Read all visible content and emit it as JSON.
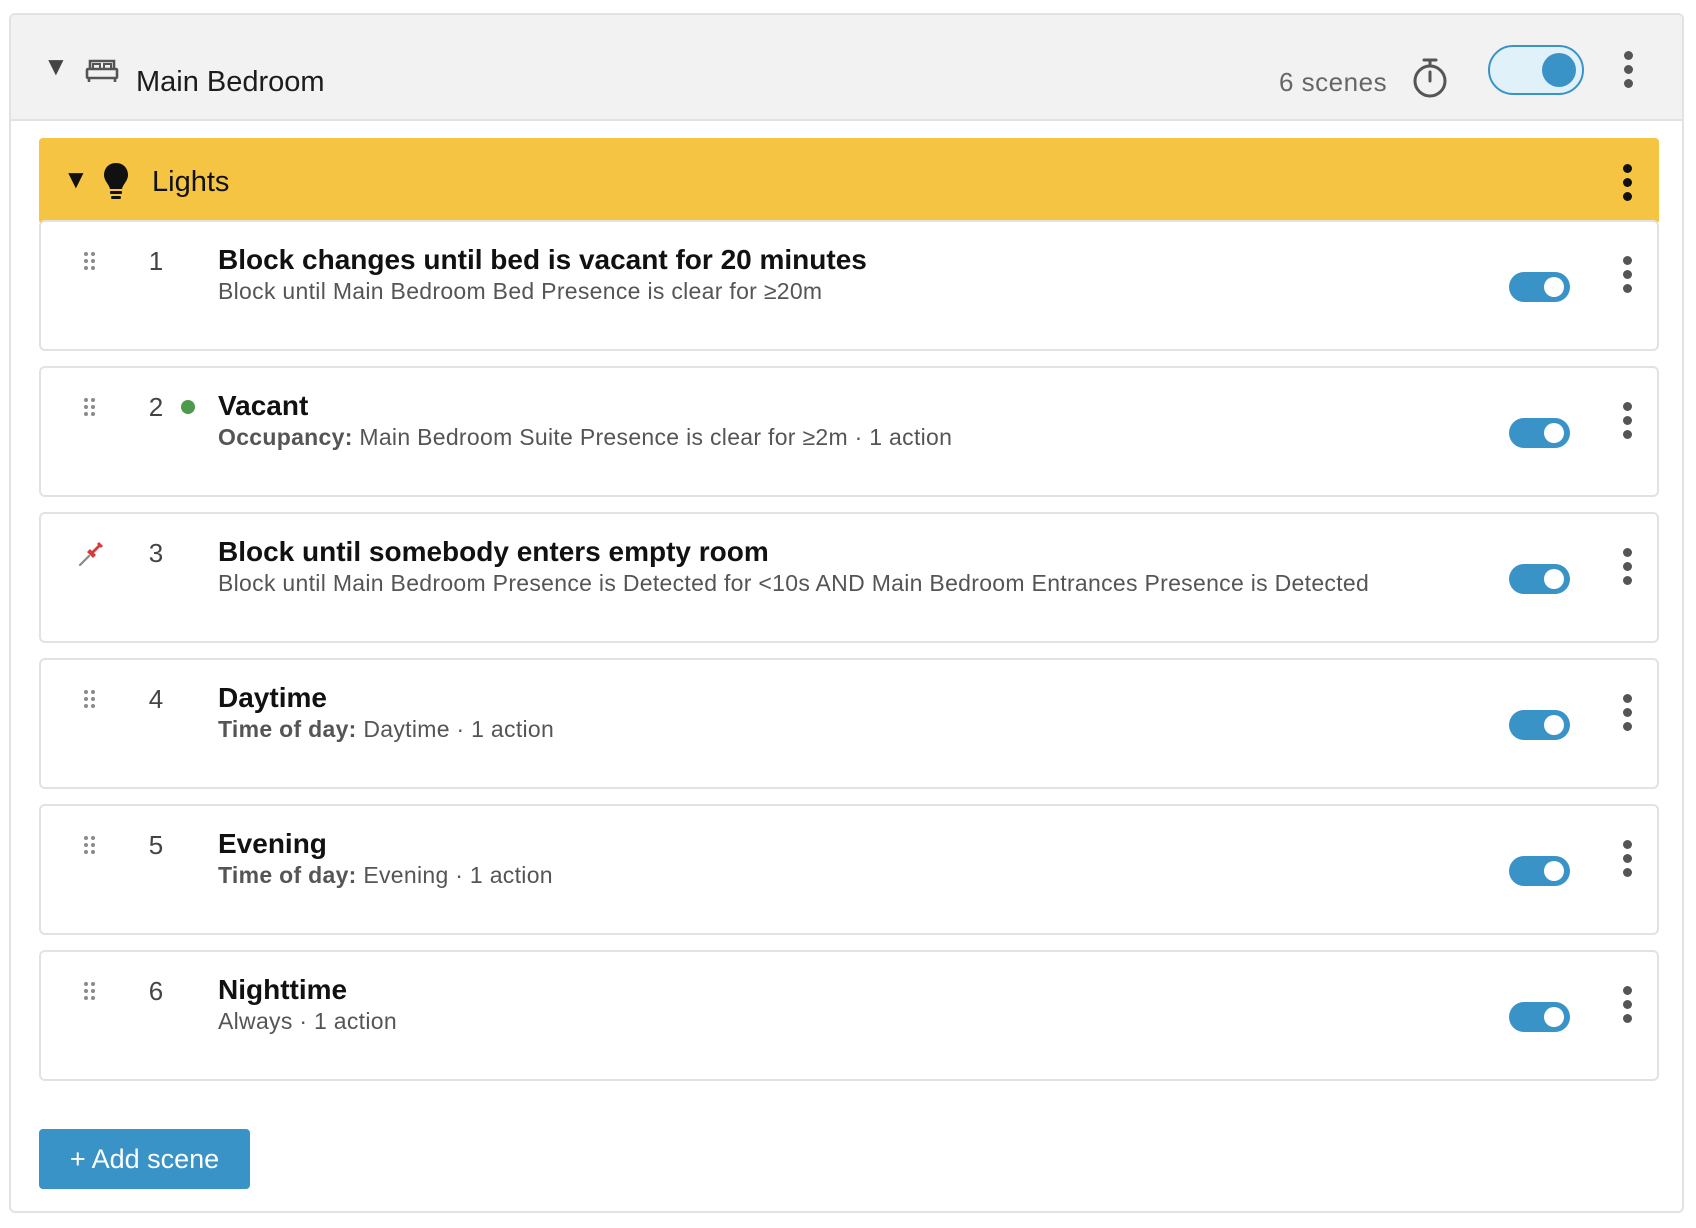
{
  "room": {
    "title": "Main Bedroom",
    "scene_count": "6 scenes",
    "enabled": true,
    "icon": "bed-icon"
  },
  "group": {
    "title": "Lights",
    "icon": "lightbulb-icon",
    "color": "#f5c443"
  },
  "scenes": [
    {
      "num": "1",
      "title": "Block changes until bed is vacant for 20 minutes",
      "sub_label": "",
      "sub_text": "Block until Main Bedroom Bed Presence is clear for ≥20m",
      "enabled": true,
      "active": false,
      "pinned": false
    },
    {
      "num": "2",
      "title": "Vacant",
      "sub_label": "Occupancy:",
      "sub_text": "Main Bedroom Suite Presence is clear for ≥2m · 1 action",
      "enabled": true,
      "active": true,
      "pinned": false
    },
    {
      "num": "3",
      "title": "Block until somebody enters empty room",
      "sub_label": "",
      "sub_text": "Block until Main Bedroom Presence is Detected for <10s AND Main Bedroom Entrances Presence is Detected",
      "enabled": true,
      "active": false,
      "pinned": true
    },
    {
      "num": "4",
      "title": "Daytime",
      "sub_label": "Time of day:",
      "sub_text": "Daytime · 1 action",
      "enabled": true,
      "active": false,
      "pinned": false
    },
    {
      "num": "5",
      "title": "Evening",
      "sub_label": "Time of day:",
      "sub_text": "Evening · 1 action",
      "enabled": true,
      "active": false,
      "pinned": false
    },
    {
      "num": "6",
      "title": "Nighttime",
      "sub_label": "",
      "sub_text": "Always · 1 action",
      "enabled": true,
      "active": false,
      "pinned": false
    }
  ],
  "add_scene_label": "+ Add scene",
  "colors": {
    "accent": "#3a93c7",
    "active_dot": "#4e9a4c",
    "pin": "#d83a3a"
  }
}
